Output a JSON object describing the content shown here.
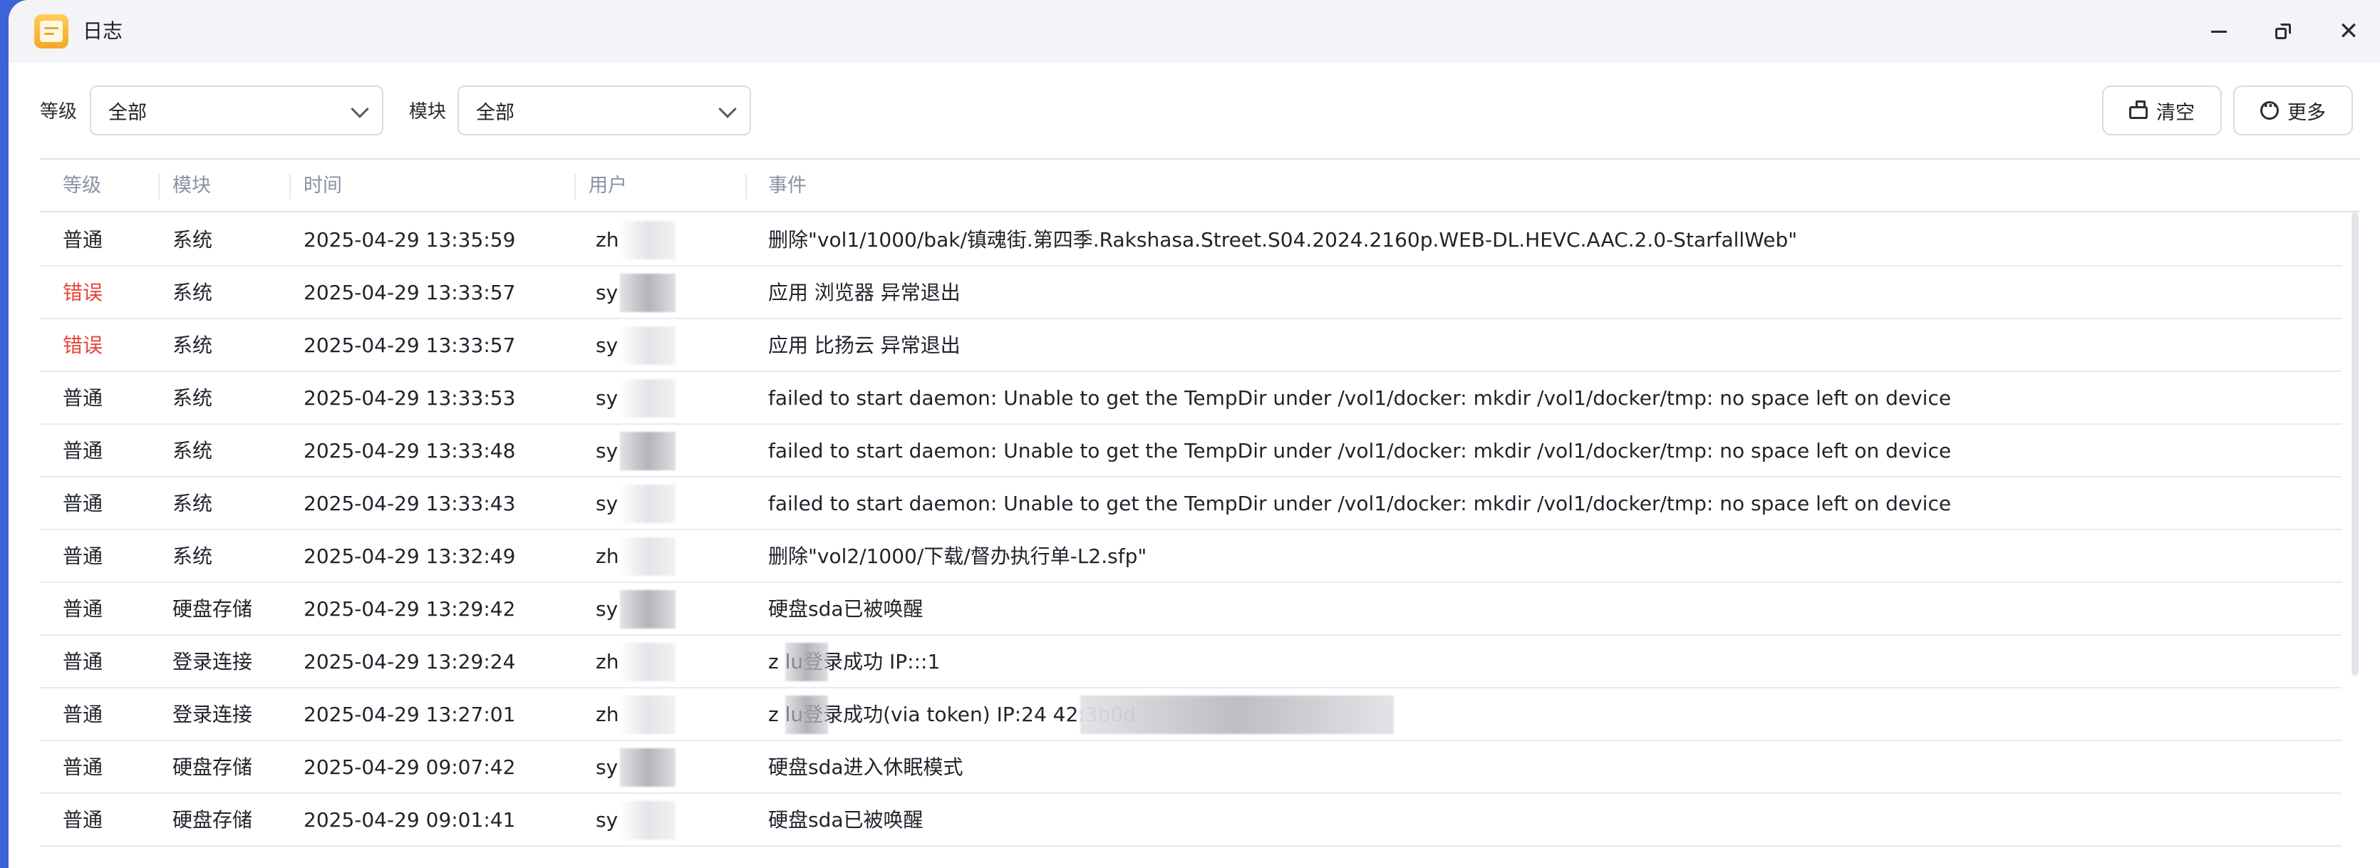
{
  "window": {
    "title": "日志",
    "controls": {
      "minimize": "minimize-icon",
      "maximize": "restore-icon",
      "close": "close-icon"
    }
  },
  "filters": {
    "level_label": "等级",
    "level_value": "全部",
    "module_label": "模块",
    "module_value": "全部",
    "clear_label": "清空",
    "more_label": "更多"
  },
  "table": {
    "headers": {
      "level": "等级",
      "module": "模块",
      "time": "时间",
      "user": "用户",
      "event": "事件"
    },
    "rows": [
      {
        "level": "普通",
        "level_type": "normal",
        "module": "系统",
        "time": "2025-04-29 13:35:59",
        "user": "zh",
        "event": "删除\"vol1/1000/bak/镇魂街.第四季.Rakshasa.Street.S04.2024.2160p.WEB-DL.HEVC.AAC.2.0-StarfallWeb\""
      },
      {
        "level": "错误",
        "level_type": "error",
        "module": "系统",
        "time": "2025-04-29 13:33:57",
        "user": "sy",
        "event": "应用 浏览器 异常退出"
      },
      {
        "level": "错误",
        "level_type": "error",
        "module": "系统",
        "time": "2025-04-29 13:33:57",
        "user": "sy",
        "event": "应用 比扬云 异常退出"
      },
      {
        "level": "普通",
        "level_type": "normal",
        "module": "系统",
        "time": "2025-04-29 13:33:53",
        "user": "sy",
        "event": "failed to start daemon: Unable to get the TempDir under /vol1/docker: mkdir /vol1/docker/tmp: no space left on device"
      },
      {
        "level": "普通",
        "level_type": "normal",
        "module": "系统",
        "time": "2025-04-29 13:33:48",
        "user": "sy",
        "event": "failed to start daemon: Unable to get the TempDir under /vol1/docker: mkdir /vol1/docker/tmp: no space left on device"
      },
      {
        "level": "普通",
        "level_type": "normal",
        "module": "系统",
        "time": "2025-04-29 13:33:43",
        "user": "sy",
        "event": "failed to start daemon: Unable to get the TempDir under /vol1/docker: mkdir /vol1/docker/tmp: no space left on device"
      },
      {
        "level": "普通",
        "level_type": "normal",
        "module": "系统",
        "time": "2025-04-29 13:32:49",
        "user": "zh",
        "event": "删除\"vol2/1000/下载/督办执行单-L2.sfp\""
      },
      {
        "level": "普通",
        "level_type": "normal",
        "module": "硬盘存储",
        "time": "2025-04-29 13:29:42",
        "user": "sy",
        "event": "硬盘sda已被唤醒"
      },
      {
        "level": "普通",
        "level_type": "normal",
        "module": "登录连接",
        "time": "2025-04-29 13:29:24",
        "user": "zh",
        "event": "z      lu登录成功 IP:::1"
      },
      {
        "level": "普通",
        "level_type": "normal",
        "module": "登录连接",
        "time": "2025-04-29 13:27:01",
        "user": "zh",
        "event": "z      lu登录成功(via token) IP:24                                              42:3b0d"
      },
      {
        "level": "普通",
        "level_type": "normal",
        "module": "硬盘存储",
        "time": "2025-04-29 09:07:42",
        "user": "sy",
        "event": "硬盘sda进入休眠模式"
      },
      {
        "level": "普通",
        "level_type": "normal",
        "module": "硬盘存储",
        "time": "2025-04-29 09:01:41",
        "user": "sy",
        "event": "硬盘sda已被唤醒"
      }
    ]
  }
}
